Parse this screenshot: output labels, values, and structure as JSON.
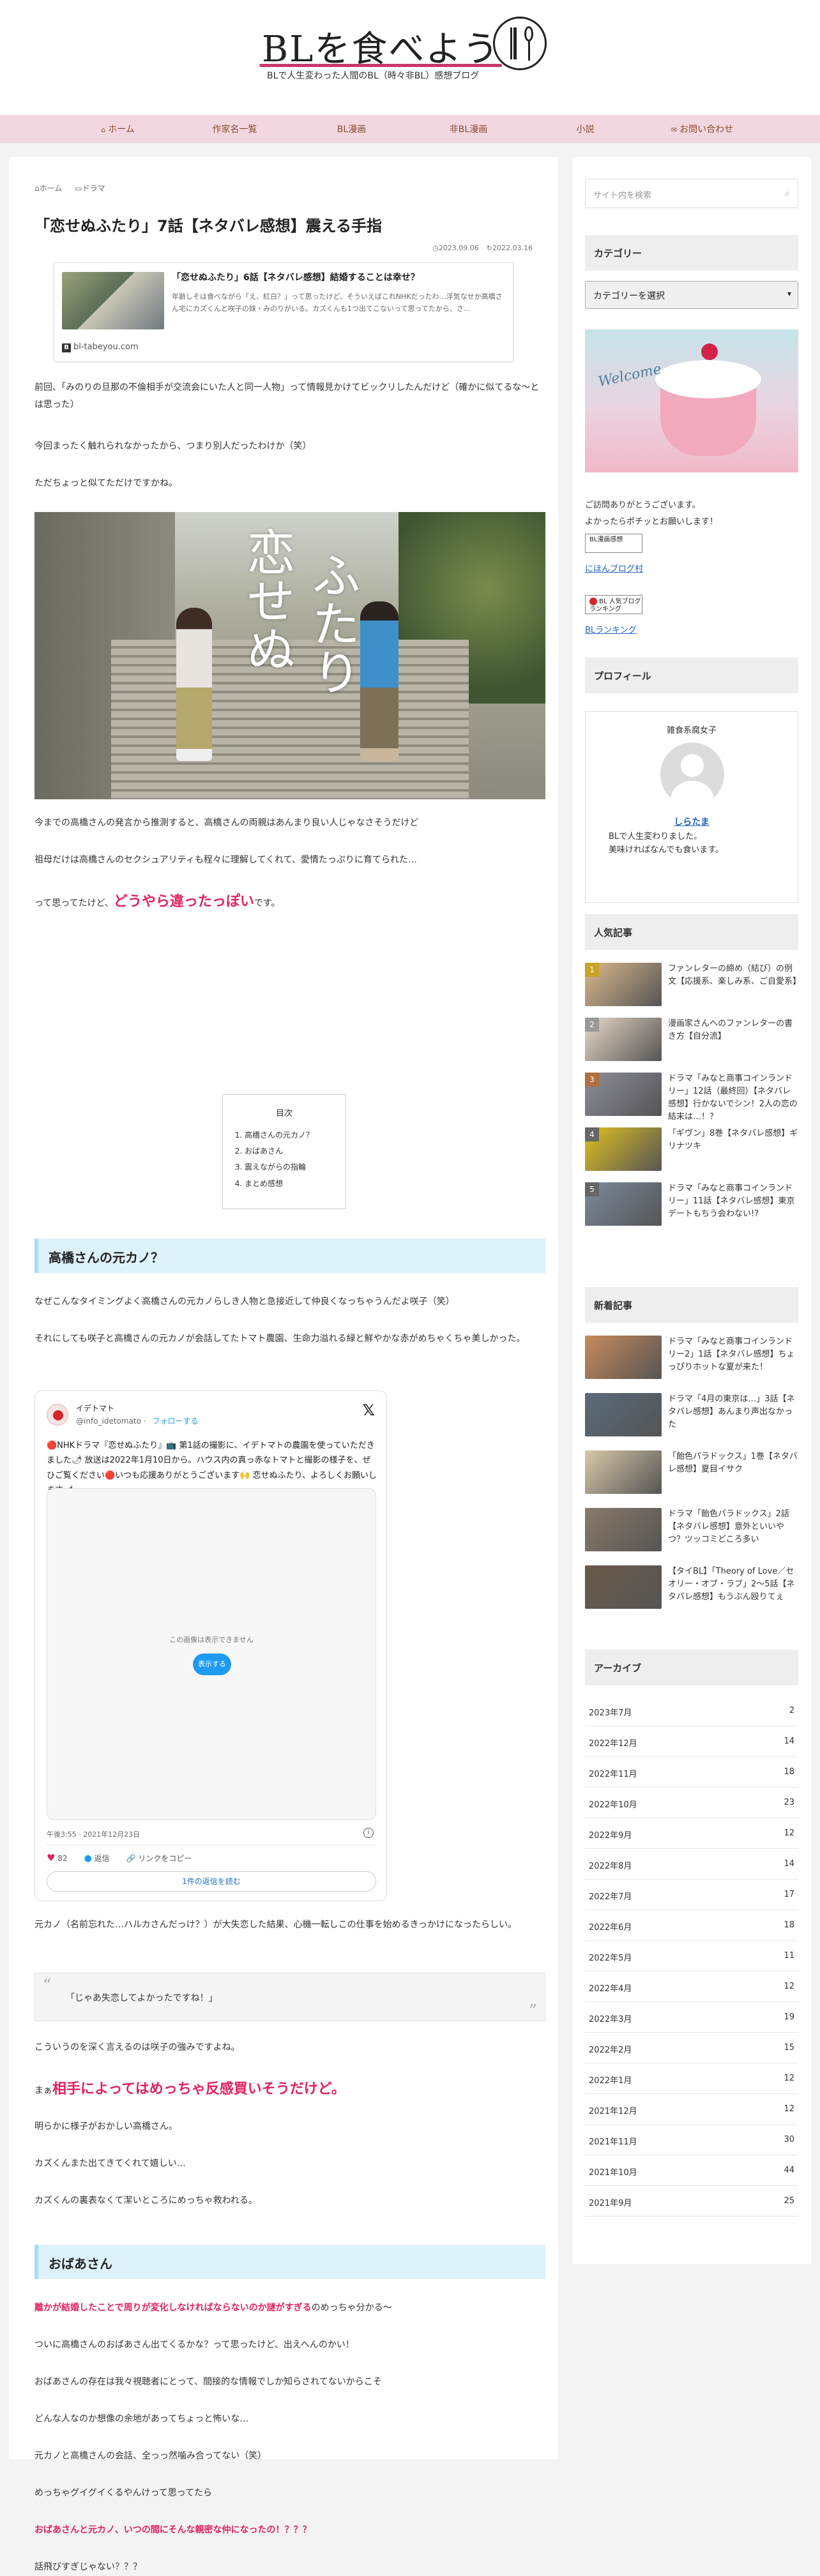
{
  "site": {
    "title": "BLを食べよう",
    "subtitle": "BLで人生変わった人間のBL（時々非BL）感想ブログ"
  },
  "nav": [
    {
      "label": "ホーム",
      "icon": "home-icon"
    },
    {
      "label": "作家名一覧"
    },
    {
      "label": "BL漫画"
    },
    {
      "label": "非BL漫画"
    },
    {
      "label": "小説"
    },
    {
      "label": "お問い合わせ",
      "icon": "mail-icon"
    }
  ],
  "article": {
    "breadcrumb": [
      "ホーム",
      "ドラマ"
    ],
    "title": "「恋せぬふたり」7話【ネタバレ感想】震える手指",
    "date_posted": "2023.09.06",
    "date_updated": "2022.03.16",
    "card": {
      "title": "「恋せぬふたり」6話【ネタバレ感想】結婚することは幸せ？",
      "text": "年齢しそは食べながら「え、紅白？」って思ったけど、そういえばこれNHKだったわ…浮気なせか高橋さん宅にカズくんと咲子の妹・みのりがいる。カズくんも1つ出てこないって思ってたから、さ…",
      "site": "bl-tabeyou.com"
    },
    "paras1": [
      "前回、「みのりの旦那の不倫相手が交流会にいた人と同一人物」って情報見かけてビックリしたんだけど（確かに似てるな〜とは思った）",
      "今回まったく触れられなかったから、つまり別人だったわけか（笑）",
      "ただちょっと似てただけですかね。"
    ],
    "hero_title_1": "恋せぬ",
    "hero_title_2": "ふたり",
    "paras2": [
      "今までの高橋さんの発言から推測すると、高橋さんの両親はあんまり良い人じゃなさそうだけど",
      "祖母だけは高橋さんのセクシュアリティも程々に理解してくれて、愛情たっぷりに育てられた…"
    ],
    "hl1_pre": "って思ってたけど、",
    "hl1": "どうやら違ったっぽい",
    "hl1_post": "です。",
    "toc": {
      "title": "目次",
      "items": [
        "高橋さんの元カノ？",
        "おばあさん",
        "震えながらの指輪",
        "まとめ感想"
      ]
    },
    "h2_1": "高橋さんの元カノ？",
    "paras3": [
      "なぜこんなタイミングよく高橋さんの元カノらしき人物と急接近して仲良くなっちゃうんだよ咲子（笑）",
      "それにしても咲子と高橋さんの元カノが会話してたトマト農園、生命力溢れる緑と鮮やかな赤がめちゃくちゃ美しかった。"
    ],
    "tweet": {
      "name": "イデトマト",
      "handle": "@info_idetomato",
      "follow": "フォローする",
      "text": "🔴NHKドラマ『恋せぬふたり』📺 第1話の撮影に、イデトマトの農園を使っていただきました🌶 放送は2022年1月10日から。ハウス内の真っ赤なトマトと撮影の様子を、ぜひご覧ください🔴いつも応援ありがとうございます🙌 恋せぬふたり、よろしくお願いします🌶",
      "media_msg": "この画像は表示できません",
      "media_btn": "表示する",
      "time": "午後3:55 · 2021年12月23日",
      "likes": "82",
      "reply": "返信",
      "copy": "リンクをコピー",
      "more": "1件の返信を読む"
    },
    "paras4": [
      "元カノ（名前忘れた…ハルカさんだっけ？）が大失恋した結果、心機一転しこの仕事を始めるきっかけになったらしい。"
    ],
    "quote": "「じゃあ失恋してよかったですね！」",
    "paras5": [
      "こういうのを深く言えるのは咲子の強みですよね。"
    ],
    "hl2_pre": "まぁ",
    "hl2": "相手によってはめっちゃ反感買いそうだけど。",
    "paras6": [
      "明らかに様子がおかしい高橋さん。",
      "カズくんまた出てきてくれて嬉しい…",
      "カズくんの裏表なくて潔いところにめっちゃ救われる。"
    ],
    "h2_2": "おばあさん",
    "hl3": "離かが結婚したことで周りが変化しなければならないのか謎がすぎる",
    "hl3_post": "のめっちゃ分かる〜",
    "paras7": [
      "ついに高橋さんのおばあさん出てくるかな？って思ったけど、出えへんのかい！",
      "おばあさんの存在は我々視聴者にとって、間接的な情報でしか知らされてないからこそ",
      "どんな人なのか想像の余地があってちょっと怖いな…",
      "元カノと高橋さんの会話、全っっ然噛み合ってない（笑）",
      "めっちゃグイグイくるやんけって思ってたら"
    ],
    "hl4": "おばあさんと元カノ、いつの間にそんな親密な仲になったの！？？？",
    "paras8": [
      "話飛びすぎじゃない？？？"
    ]
  },
  "sidebar": {
    "search_placeholder": "サイト内を検索",
    "category_title": "カテゴリー",
    "category_select": "カテゴリーを選択",
    "welcome_text": "Welcome",
    "thanks": [
      "ご訪問ありがとうございます。",
      "よかったらポチッとお願いします！"
    ],
    "badge1": "BL漫画感想",
    "link1": "にほんブログ村",
    "badge2": "BL 人気ブログランキング",
    "link2": "BLランキング",
    "profile_title": "プロフィール",
    "profile": {
      "label": "雑食系腐女子",
      "name": "しらたま",
      "desc": [
        "BLで人生変わりました。",
        "美味ければなんでも食います。"
      ]
    },
    "popular_title": "人気記事",
    "popular": [
      {
        "rank": "1",
        "title": "ファンレターの締め（結び）の例文【応援系、楽しみ系、ご自愛系】",
        "color": "#d9b98c"
      },
      {
        "rank": "2",
        "title": "漫画家さんへのファンレターの書き方【自分流】",
        "color": "#e8d8c8"
      },
      {
        "rank": "3",
        "title": "ドラマ「みなと商事コインランドリー」12話（最終回）【ネタバレ感想】行かないでシン！2人の恋の結末は…！？",
        "color": "#8d8d9a"
      },
      {
        "rank": "4",
        "title": "「ギヴン」8巻【ネタバレ感想】ギリナツキ",
        "color": "#e0c020"
      },
      {
        "rank": "5",
        "title": "ドラマ「みなと商事コインランドリー」11話【ネタバレ感想】東京デートもちう会わない!?",
        "color": "#7c8a9c"
      }
    ],
    "new_title": "新着記事",
    "new": [
      {
        "title": "ドラマ「みなと商事コインランドリー2」1話【ネタバレ感想】ちょっぴりホットな夏が来た！",
        "color": "#c88a5a"
      },
      {
        "title": "ドラマ「4月の東京は…」3話【ネタバレ感想】あんまり声出なかった",
        "color": "#5a6a7a"
      },
      {
        "title": "「飴色パラドックス」1巻【ネタバレ感想】夏目イサク",
        "color": "#d8c8a8"
      },
      {
        "title": "ドラマ「飴色パラドックス」2話【ネタバレ感想】意外といいやつ？ツッコミどころ多い",
        "color": "#8a7a6a"
      },
      {
        "title": "【タイBL】「Theory of Love／セオリー・オブ・ラブ」2〜5話【ネタバレ感想】もうぶん殴りてぇ",
        "color": "#6a5a4a"
      }
    ],
    "archive_title": "アーカイブ",
    "archive": [
      {
        "month": "2023年7月",
        "count": "2"
      },
      {
        "month": "2022年12月",
        "count": "14"
      },
      {
        "month": "2022年11月",
        "count": "18"
      },
      {
        "month": "2022年10月",
        "count": "23"
      },
      {
        "month": "2022年9月",
        "count": "12"
      },
      {
        "month": "2022年8月",
        "count": "14"
      },
      {
        "month": "2022年7月",
        "count": "17"
      },
      {
        "month": "2022年6月",
        "count": "18"
      },
      {
        "month": "2022年5月",
        "count": "11"
      },
      {
        "month": "2022年4月",
        "count": "12"
      },
      {
        "month": "2022年3月",
        "count": "19"
      },
      {
        "month": "2022年2月",
        "count": "15"
      },
      {
        "month": "2022年1月",
        "count": "12"
      },
      {
        "month": "2021年12月",
        "count": "12"
      },
      {
        "month": "2021年11月",
        "count": "30"
      },
      {
        "month": "2021年10月",
        "count": "44"
      },
      {
        "month": "2021年9月",
        "count": "25"
      }
    ]
  }
}
